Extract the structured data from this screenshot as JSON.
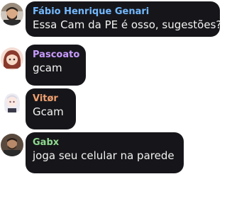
{
  "messages": [
    {
      "author": "Fábio Henrique Genari",
      "text": "Essa Cam da PE é osso, sugestões?",
      "name_color": "#74b9ff",
      "avatar_icon": "bearded-man-avatar"
    },
    {
      "author": "Pascoato",
      "text": "gcam",
      "name_color": "#c89bff",
      "avatar_icon": "anime-girl-avatar"
    },
    {
      "author": "Vitør",
      "text": "Gcam",
      "name_color": "#f0a070",
      "avatar_icon": "white-haired-anime-avatar"
    },
    {
      "author": "Gabx",
      "text": "joga seu celular na parede",
      "name_color": "#8fd98f",
      "avatar_icon": "man-photo-avatar"
    }
  ]
}
